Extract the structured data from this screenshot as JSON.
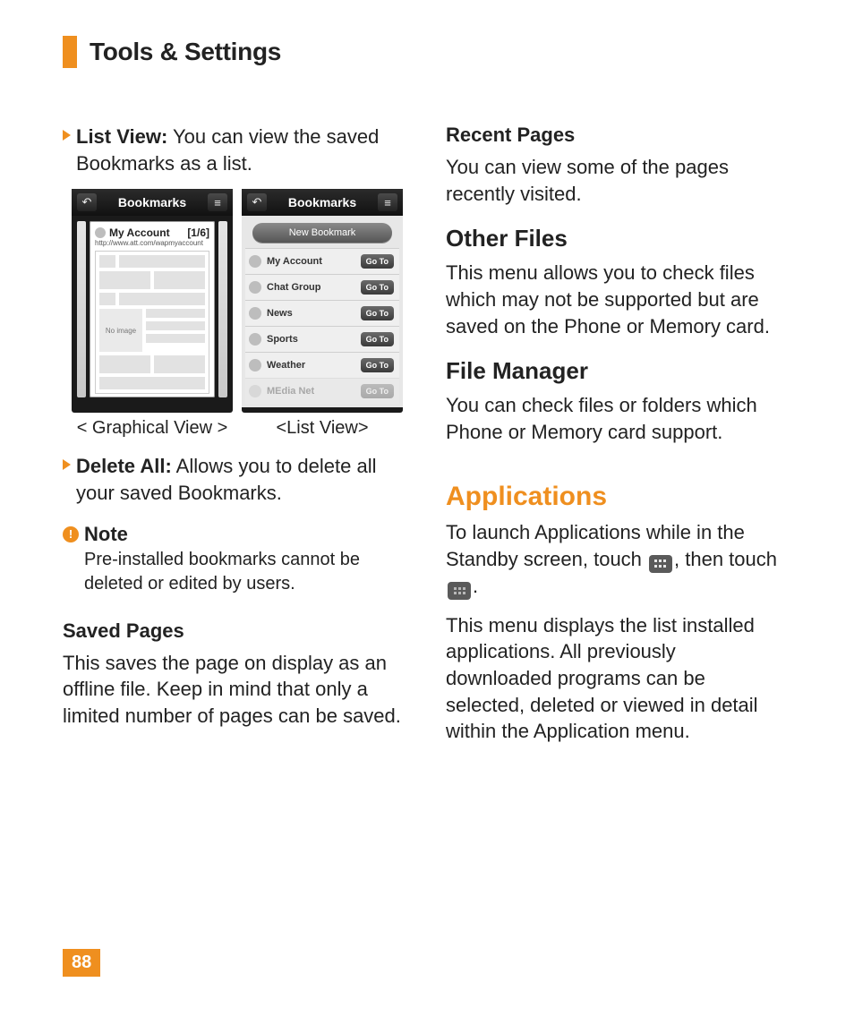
{
  "header": {
    "title": "Tools & Settings"
  },
  "col1": {
    "listView": {
      "label": "List View:",
      "text": " You can view the saved Bookmarks as a list."
    },
    "graphical": {
      "barTitle": "Bookmarks",
      "account": "My Account",
      "count": "[1/6]",
      "url": "http://www.att.com/wapmyaccount",
      "noImage": "No image",
      "caption": "< Graphical View >"
    },
    "list": {
      "barTitle": "Bookmarks",
      "newBookmark": "New Bookmark",
      "items": [
        {
          "label": "My Account",
          "goto": "Go To"
        },
        {
          "label": "Chat Group",
          "goto": "Go To"
        },
        {
          "label": "News",
          "goto": "Go To"
        },
        {
          "label": "Sports",
          "goto": "Go To"
        },
        {
          "label": "Weather",
          "goto": "Go To"
        },
        {
          "label": "MEdia Net",
          "goto": "Go To"
        }
      ],
      "caption": "<List View>"
    },
    "deleteAll": {
      "label": "Delete All:",
      "text": " Allows you to delete all your saved Bookmarks."
    },
    "note": {
      "label": "Note",
      "body": "Pre-installed bookmarks cannot be deleted or edited by users."
    },
    "savedPages": {
      "heading": "Saved Pages",
      "body": "This saves the page on display as an offline file. Keep in mind that only a limited number of pages can be saved."
    }
  },
  "col2": {
    "recentPages": {
      "heading": "Recent Pages",
      "body": "You can view some of the pages recently visited."
    },
    "otherFiles": {
      "heading": "Other Files",
      "body": "This menu allows you to check files which may not be supported but are saved on the Phone or Memory card."
    },
    "fileManager": {
      "heading": "File Manager",
      "body": "You can check files or folders which Phone or Memory card support."
    },
    "applications": {
      "heading": "Applications",
      "lead1": "To launch Applications while in the Standby screen, touch ",
      "lead2": ", then touch ",
      "lead3": ".",
      "body2": "This menu displays the list installed applications. All previously downloaded programs can be selected, deleted or viewed in detail within the Application menu."
    }
  },
  "pageNumber": "88"
}
